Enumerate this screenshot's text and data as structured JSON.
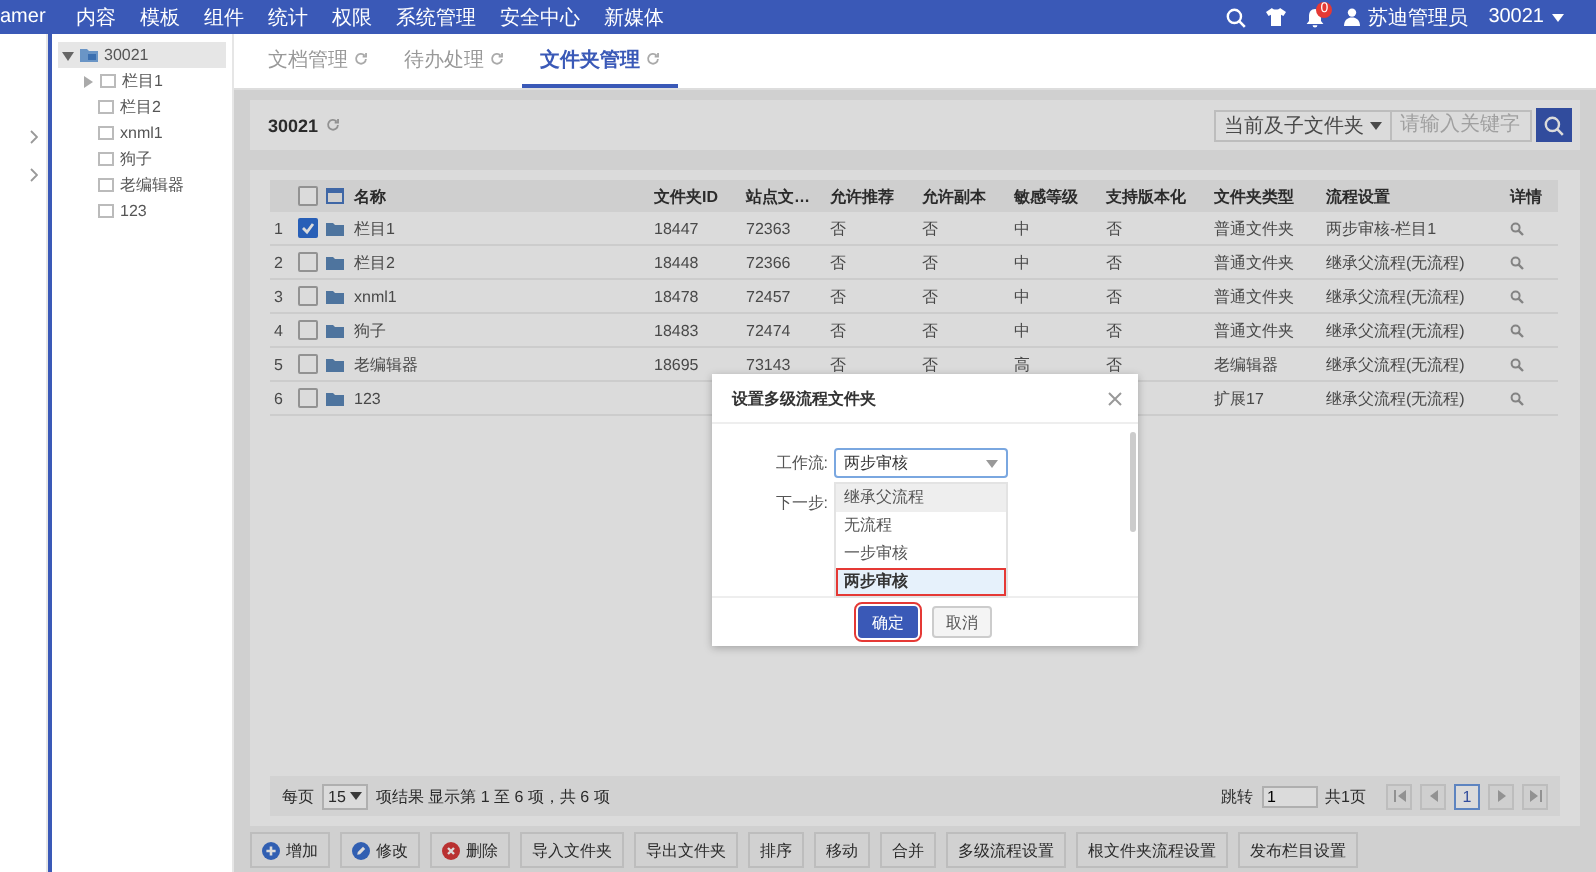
{
  "top_bar": {
    "brand": "amer",
    "menu": [
      "内容",
      "模板",
      "组件",
      "统计",
      "权限",
      "系统管理",
      "安全中心",
      "新媒体"
    ],
    "notification_count": "0",
    "user": "苏迪管理员",
    "site": "30021"
  },
  "tree": [
    {
      "label": "30021",
      "expandable": true,
      "expanded": true,
      "selected": true,
      "children": [
        {
          "label": "栏目1",
          "expandable": true,
          "expanded": false,
          "selected": false
        },
        {
          "label": "栏目2",
          "expandable": false,
          "expanded": false,
          "selected": false
        },
        {
          "label": "xnml1",
          "expandable": false,
          "expanded": false,
          "selected": false
        },
        {
          "label": "狗子",
          "expandable": false,
          "expanded": false,
          "selected": false
        },
        {
          "label": "老编辑器",
          "expandable": false,
          "expanded": false,
          "selected": false
        },
        {
          "label": "123",
          "expandable": false,
          "expanded": false,
          "selected": false
        }
      ]
    }
  ],
  "tabs": [
    {
      "label": "文档管理",
      "selected": false
    },
    {
      "label": "待办处理",
      "selected": false
    },
    {
      "label": "文件夹管理",
      "selected": true
    }
  ],
  "breadcrumb": "30021",
  "search": {
    "scope": "当前及子文件夹",
    "placeholder": "请输入关键字"
  },
  "table": {
    "select_all_checked": false,
    "columns": [
      "名称",
      "文件夹ID",
      "站点文…",
      "允许推荐",
      "允许副本",
      "敏感等级",
      "支持版本化",
      "文件夹类型",
      "流程设置",
      "详情"
    ],
    "rows": [
      {
        "index": "1",
        "checked": true,
        "cells": [
          "栏目1",
          "18447",
          "72363",
          "否",
          "否",
          "中",
          "否",
          "普通文件夹",
          "两步审核-栏目1"
        ]
      },
      {
        "index": "2",
        "checked": false,
        "cells": [
          "栏目2",
          "18448",
          "72366",
          "否",
          "否",
          "中",
          "否",
          "普通文件夹",
          "继承父流程(无流程)"
        ]
      },
      {
        "index": "3",
        "checked": false,
        "cells": [
          "xnml1",
          "18478",
          "72457",
          "否",
          "否",
          "中",
          "否",
          "普通文件夹",
          "继承父流程(无流程)"
        ]
      },
      {
        "index": "4",
        "checked": false,
        "cells": [
          "狗子",
          "18483",
          "72474",
          "否",
          "否",
          "中",
          "否",
          "普通文件夹",
          "继承父流程(无流程)"
        ]
      },
      {
        "index": "5",
        "checked": false,
        "cells": [
          "老编辑器",
          "18695",
          "73143",
          "否",
          "否",
          "高",
          "否",
          "老编辑器",
          "继承父流程(无流程)"
        ]
      },
      {
        "index": "6",
        "checked": false,
        "cells": [
          "123",
          null,
          null,
          null,
          null,
          null,
          null,
          "扩展17",
          "继承父流程(无流程)"
        ]
      }
    ]
  },
  "pagination": {
    "per_page_label": "每页",
    "page_size": "15",
    "summary": "项结果 显示第 1 至 6 项，共 6 项",
    "jump_label": "跳转",
    "jump_value": "1",
    "total_pages": "共1页",
    "pages": [
      {
        "label": "1",
        "selected": true
      }
    ]
  },
  "actions": [
    {
      "label": "增加",
      "kind": "add"
    },
    {
      "label": "修改",
      "kind": "edit"
    },
    {
      "label": "删除",
      "kind": "delete"
    },
    {
      "label": "导入文件夹",
      "kind": "plain"
    },
    {
      "label": "导出文件夹",
      "kind": "plain"
    },
    {
      "label": "排序",
      "kind": "plain"
    },
    {
      "label": "移动",
      "kind": "plain"
    },
    {
      "label": "合并",
      "kind": "plain"
    },
    {
      "label": "多级流程设置",
      "kind": "plain"
    },
    {
      "label": "根文件夹流程设置",
      "kind": "plain"
    },
    {
      "label": "发布栏目设置",
      "kind": "plain"
    }
  ],
  "modal": {
    "title": "设置多级流程文件夹",
    "workflow_label": "工作流:",
    "workflow_value": "两步审核",
    "next_step_label": "下一步:",
    "options": [
      {
        "label": "继承父流程",
        "selected": false,
        "hovered": true,
        "highlighted": false
      },
      {
        "label": "无流程",
        "selected": false,
        "hovered": false,
        "highlighted": false
      },
      {
        "label": "一步审核",
        "selected": false,
        "hovered": false,
        "highlighted": false
      },
      {
        "label": "两步审核",
        "selected": true,
        "hovered": false,
        "highlighted": true
      }
    ],
    "buttons": [
      {
        "label": "确定",
        "kind": "primary",
        "highlighted": true
      },
      {
        "label": "取消",
        "kind": "default",
        "highlighted": false
      }
    ]
  }
}
